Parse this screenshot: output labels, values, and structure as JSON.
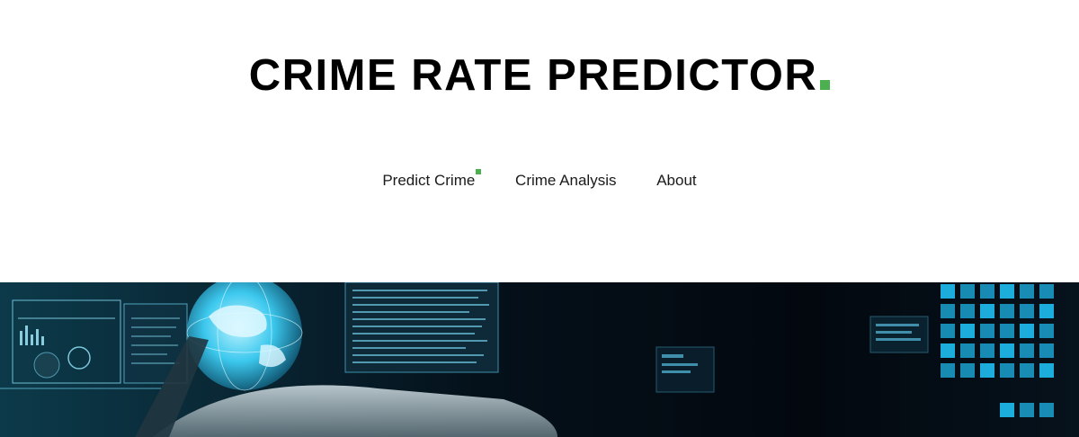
{
  "header": {
    "title": "CRIME RATE PREDICTOR"
  },
  "nav": {
    "items": [
      {
        "label": "Predict Crime",
        "active": true
      },
      {
        "label": "Crime Analysis",
        "active": false
      },
      {
        "label": "About",
        "active": false
      }
    ]
  },
  "colors": {
    "accent": "#4caf50",
    "title": "#000000",
    "banner_dark": "#050b13",
    "banner_cyan": "#1fb6e8"
  },
  "banner": {
    "icon": "cyber-technology-globe-image"
  }
}
